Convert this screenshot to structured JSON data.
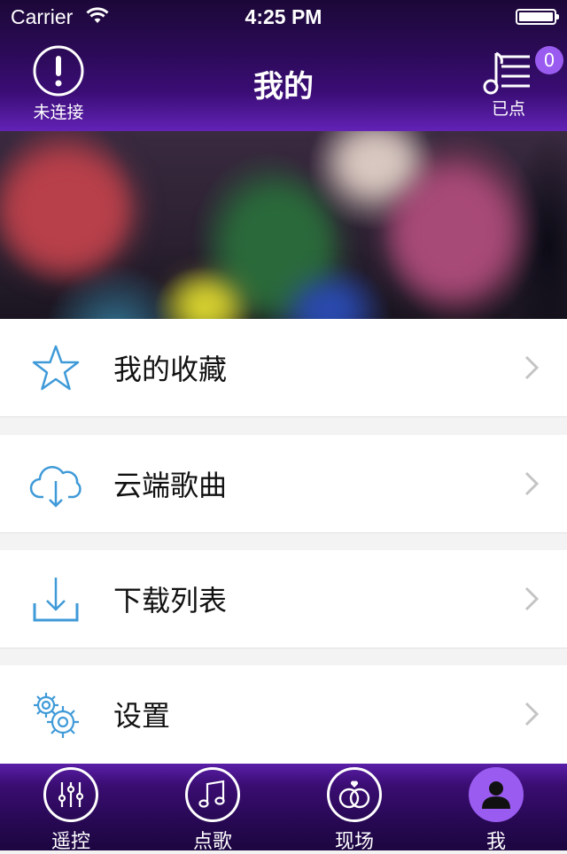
{
  "status_bar": {
    "carrier": "Carrier",
    "time": "4:25 PM"
  },
  "nav": {
    "title": "我的",
    "left_label": "未连接",
    "left_icon": "alert-icon",
    "right_label": "已点",
    "right_icon": "playlist-icon",
    "badge_count": "0"
  },
  "banner": {
    "icon": "blurred-photo"
  },
  "menu": [
    {
      "label": "我的收藏",
      "icon": "star-icon"
    },
    {
      "label": "云端歌曲",
      "icon": "cloud-download-icon"
    },
    {
      "label": "下载列表",
      "icon": "download-icon"
    },
    {
      "label": "设置",
      "icon": "gear-icon"
    }
  ],
  "tabbar": [
    {
      "label": "遥控",
      "icon": "equalizer-icon"
    },
    {
      "label": "点歌",
      "icon": "music-note-icon"
    },
    {
      "label": "现场",
      "icon": "rings-icon"
    },
    {
      "label": "我",
      "icon": "person-icon",
      "active": true
    }
  ],
  "colors": {
    "accent": "#9a5cf0",
    "icon_blue": "#3f9ad8",
    "bar_dark": "#260851"
  }
}
